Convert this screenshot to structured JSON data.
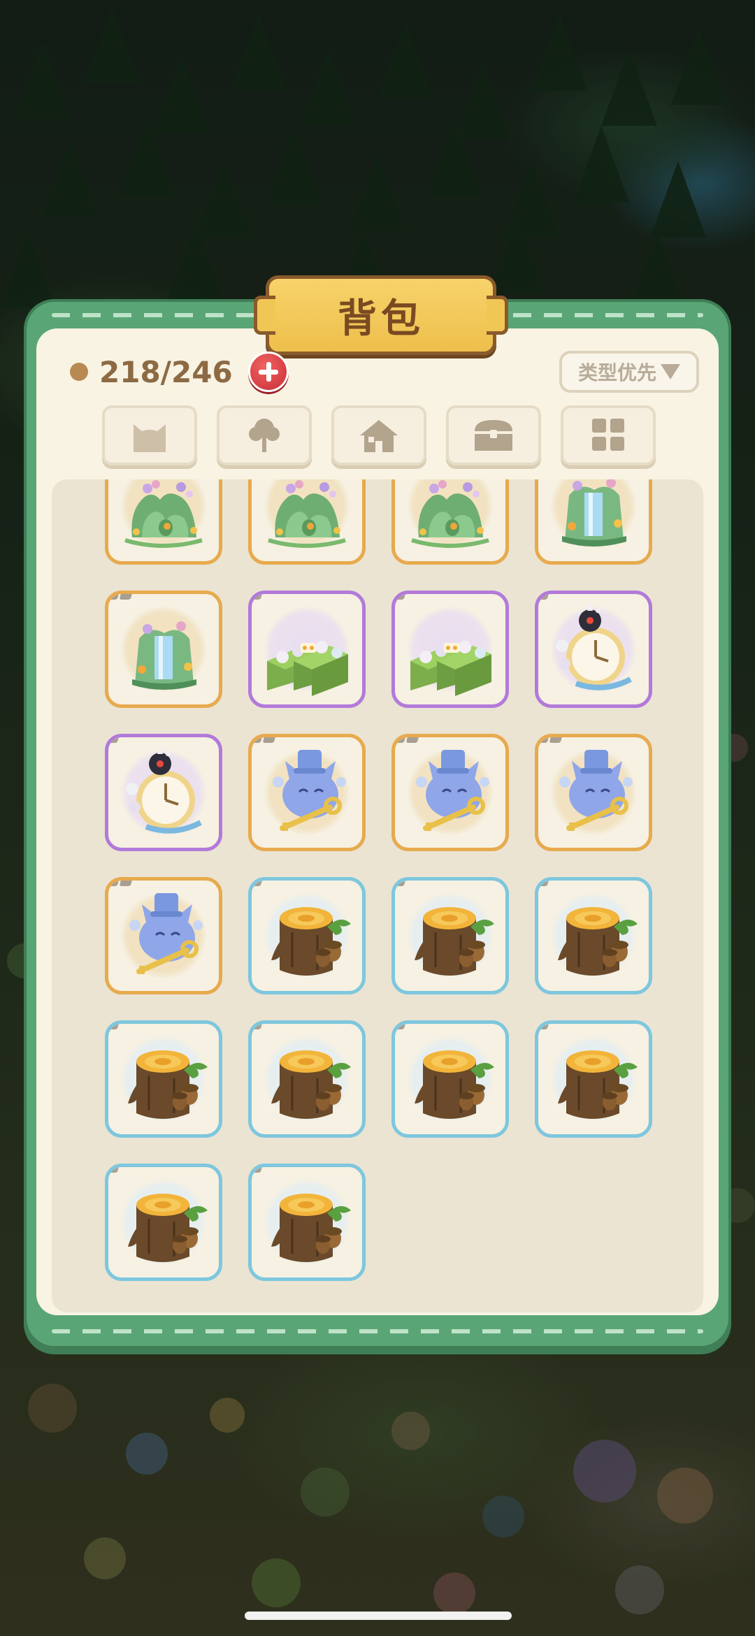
{
  "window": {
    "title": "背包"
  },
  "capacity": {
    "text": "218/246"
  },
  "sort": {
    "label": "类型优先"
  },
  "tabs": [
    {
      "icon": "cat-icon"
    },
    {
      "icon": "tree-icon"
    },
    {
      "icon": "house-icon"
    },
    {
      "icon": "treasure-chest-icon"
    },
    {
      "icon": "grid-icon"
    }
  ],
  "items": [
    {
      "kind": "flower-rock",
      "rarity": "gold",
      "badge": 0
    },
    {
      "kind": "flower-rock",
      "rarity": "gold",
      "badge": 0
    },
    {
      "kind": "flower-rock",
      "rarity": "gold",
      "badge": 0
    },
    {
      "kind": "waterfall-rock",
      "rarity": "gold",
      "badge": 0
    },
    {
      "kind": "waterfall-rock",
      "rarity": "gold",
      "badge": 2
    },
    {
      "kind": "rose-hedge",
      "rarity": "purple",
      "badge": 1
    },
    {
      "kind": "rose-hedge",
      "rarity": "purple",
      "badge": 1
    },
    {
      "kind": "pocket-clock",
      "rarity": "purple",
      "badge": 1
    },
    {
      "kind": "pocket-clock",
      "rarity": "purple",
      "badge": 1
    },
    {
      "kind": "blue-cat-key",
      "rarity": "gold",
      "badge": 2
    },
    {
      "kind": "blue-cat-key",
      "rarity": "gold",
      "badge": 2
    },
    {
      "kind": "blue-cat-key",
      "rarity": "gold",
      "badge": 2
    },
    {
      "kind": "blue-cat-key",
      "rarity": "gold",
      "badge": 2
    },
    {
      "kind": "tree-stump",
      "rarity": "blue",
      "badge": 1
    },
    {
      "kind": "tree-stump",
      "rarity": "blue",
      "badge": 1
    },
    {
      "kind": "tree-stump",
      "rarity": "blue",
      "badge": 1
    },
    {
      "kind": "tree-stump",
      "rarity": "blue",
      "badge": 1
    },
    {
      "kind": "tree-stump",
      "rarity": "blue",
      "badge": 1
    },
    {
      "kind": "tree-stump",
      "rarity": "blue",
      "badge": 1
    },
    {
      "kind": "tree-stump",
      "rarity": "blue",
      "badge": 1
    },
    {
      "kind": "tree-stump",
      "rarity": "blue",
      "badge": 1
    },
    {
      "kind": "tree-stump",
      "rarity": "blue",
      "badge": 1
    }
  ],
  "colors": {
    "panel_frame": "#5aa576",
    "panel_inner": "#f8f3e3",
    "title_plate": "#f0c655",
    "rarity_gold": "#e7aa4e",
    "rarity_purple": "#b27ad9",
    "rarity_blue": "#7ec7de",
    "add_button": "#d83a41"
  }
}
